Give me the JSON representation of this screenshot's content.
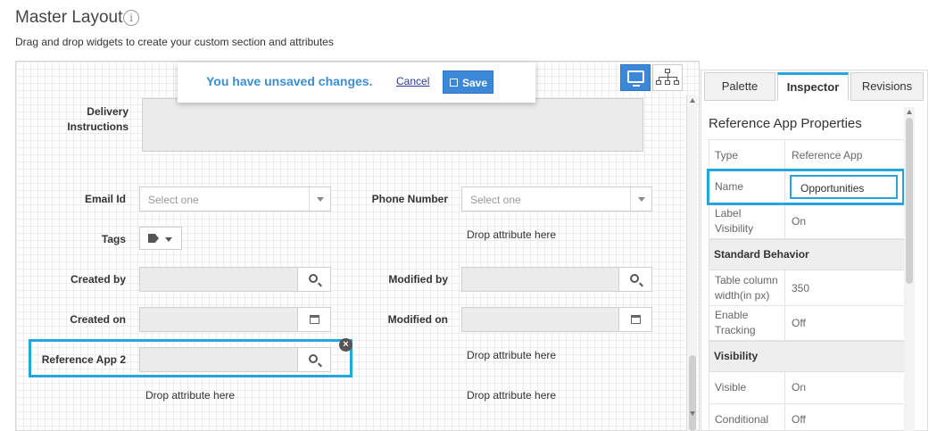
{
  "header": {
    "title": "Master Layout",
    "info_icon": "i",
    "subtitle": "Drag and drop widgets to create your custom section and attributes"
  },
  "notice": {
    "message": "You have unsaved changes.",
    "cancel_label": "Cancel",
    "save_label": "Save"
  },
  "form": {
    "delivery_label_1": "Delivery",
    "delivery_label_2": "Instructions",
    "email_label": "Email Id",
    "email_placeholder": "Select one",
    "phone_label": "Phone Number",
    "phone_placeholder": "Select one",
    "tags_label": "Tags",
    "created_by_label": "Created by",
    "modified_by_label": "Modified by",
    "created_on_label": "Created on",
    "modified_on_label": "Modified on",
    "ref_app_label": "Reference App 2",
    "drop_text": "Drop attribute here",
    "close_glyph": "×"
  },
  "panel": {
    "tabs": [
      "Palette",
      "Inspector",
      "Revisions"
    ],
    "active_tab": "Inspector",
    "title": "Reference App Properties",
    "rows": {
      "type_key": "Type",
      "type_val": "Reference App",
      "name_key": "Name",
      "name_val": "Opportunities",
      "label_vis_key_1": "Label",
      "label_vis_key_2": "Visibility",
      "label_vis_val": "On",
      "std_behavior": "Standard Behavior",
      "width_key_1": "Table column",
      "width_key_2": "width(in px)",
      "width_val": "350",
      "tracking_key_1": "Enable",
      "tracking_key_2": "Tracking",
      "tracking_val": "Off",
      "visibility_section": "Visibility",
      "visible_key": "Visible",
      "visible_val": "On",
      "conditional_key": "Conditional",
      "conditional_val": "Off"
    }
  },
  "colors": {
    "accent": "#27a3de",
    "save_button": "#3b87d8",
    "notice_text": "#3a8fd6"
  }
}
